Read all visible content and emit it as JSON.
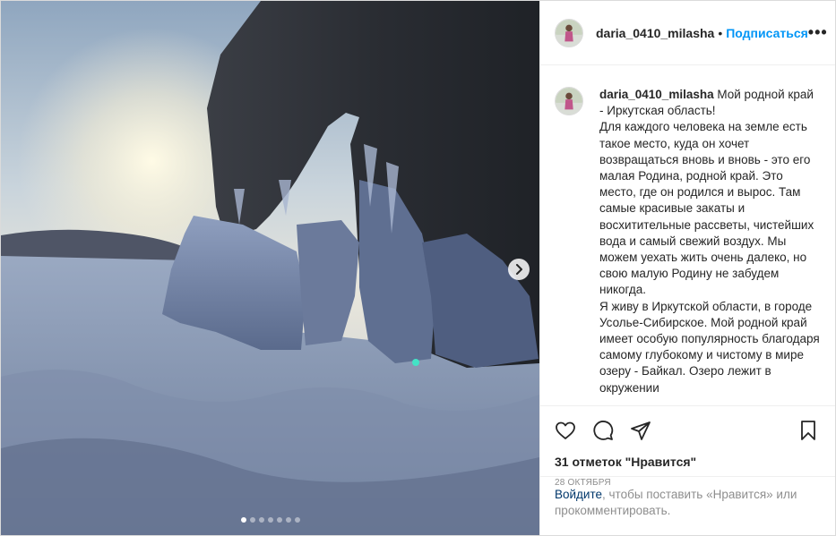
{
  "post": {
    "username": "daria_0410_milasha",
    "separator": "•",
    "follow_label": "Подписаться",
    "more_label": "•••"
  },
  "caption": {
    "username": "daria_0410_milasha",
    "lines": [
      "Мой родной край - Иркутская область!",
      "Для каждого человека на земле есть такое место, куда он хочет возвращаться вновь и вновь - это его малая Родина, родной край. Это место, где он родился и вырос. Там самые красивые закаты и восхитительные рассветы, чистейших вода и самый свежий воздух. Мы можем уехать жить очень далеко, но свою малую Родину не забудем никогда.",
      "Я живу в Иркутской области, в городе Усолье-Сибирское. Мой родной край имеет особую популярность благодаря самому глубокому и чистому в мире озеру - Байкал. Озеро лежит в окружении"
    ]
  },
  "media": {
    "carousel_count": 7,
    "active_index": 0,
    "next_icon": "chevron-right-icon"
  },
  "actions": {
    "likes_text": "31 отметок \"Нравится\"",
    "date_text": "28 октября",
    "icons": [
      "heart-icon",
      "comment-icon",
      "share-icon",
      "bookmark-icon"
    ]
  },
  "login": {
    "link_text": "Войдите",
    "rest_text": ", чтобы поставить «Нравится» или прокомментировать."
  },
  "colors": {
    "accent": "#0095f6",
    "link": "#00376b",
    "muted": "#8e8e8e",
    "border": "#dbdbdb"
  }
}
